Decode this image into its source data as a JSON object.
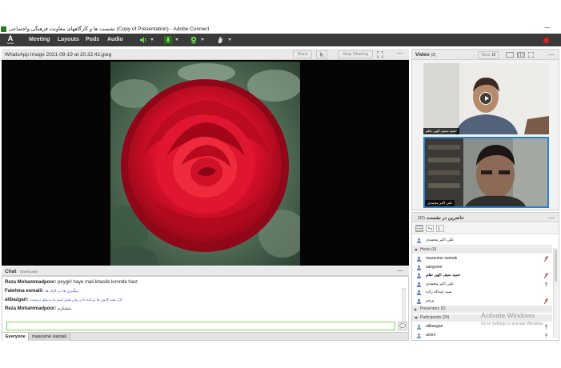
{
  "window": {
    "title": "نشست ها و کارگاههای معاونت فرهنگی واجتماعی (Copy of Presentation) - Adobe Connect",
    "minimize": "—"
  },
  "menubar": {
    "logo_letter": "A",
    "logo_sub": "Adobe",
    "items": [
      "Meeting",
      "Layouts",
      "Pods",
      "Audio"
    ]
  },
  "share_pod": {
    "title": "WhatsApp Image 2021-09-19 at 20.32.42.jpeg",
    "draw_label": "Draw",
    "stop_sharing_label": "Stop Sharing"
  },
  "chat_pod": {
    "title": "Chat",
    "scope": "(Everyone)",
    "messages": [
      {
        "sender": "Reza Mohammadpoor:",
        "text": "peygiri haye mali khasile konnde hast",
        "rtl": false
      },
      {
        "sender": "Fatehma esmaili:",
        "text": "پیگیری ها ب لایک ها",
        "rtl": true
      },
      {
        "sender": "alibazgari:",
        "text": "الان همه کانون ها برنامه دادن ولی هنوز اسم ما به ملق نرسیده",
        "rtl": true
      },
      {
        "sender": "Reza Mohammadpoor:",
        "text": "متشکرم",
        "rtl": true
      }
    ],
    "tabs": [
      "Everyone",
      "masoume siamak"
    ]
  },
  "video_pod": {
    "title": "Video",
    "count": "(2)",
    "stop_label": "Stop",
    "tiles": [
      {
        "name": "حمید سیف الهی نظم"
      },
      {
        "name": "علی اکبر محمدی"
      }
    ]
  },
  "attendees_pod": {
    "title": "حاضرین در نشست",
    "count": "(32)",
    "presenter_name": "علی اکبر محمدی",
    "groups": {
      "hosts": "Hosts (6)",
      "presenters": "Presenters (0)",
      "participants": "Participants (26)"
    },
    "hosts": [
      "masoume siamak",
      "sangooni",
      "حمید سیف الهی نظم",
      "علی اکبر محمدی",
      "سید عبداله زاده",
      "پرچم"
    ],
    "participants": [
      "alibazgari",
      "amini"
    ]
  },
  "windows_watermark": {
    "line1": "Activate Windows",
    "line2": "Go to Settings to activate Windows."
  },
  "colors": {
    "menubar": "#3a3a3a",
    "accent_green": "#7ed85a",
    "record_red": "#e02020",
    "selected_video_border": "#2a7fd8"
  }
}
